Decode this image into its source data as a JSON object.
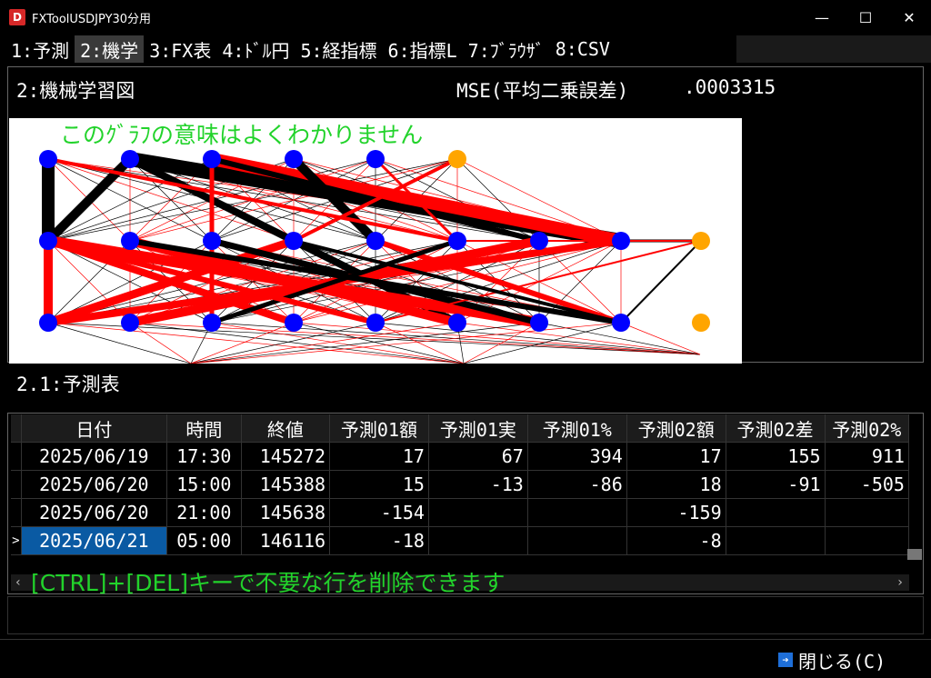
{
  "window": {
    "title": "FXToolUSDJPY30分用",
    "icon_letter": "D"
  },
  "tabs": [
    {
      "label": "1:予測",
      "active": false
    },
    {
      "label": "2:機学",
      "active": true
    },
    {
      "label": "3:FX表",
      "active": false
    },
    {
      "label": "4:ﾄﾞﾙ円",
      "active": false
    },
    {
      "label": "5:経指標",
      "active": false
    },
    {
      "label": "6:指標L",
      "active": false
    },
    {
      "label": "7:ﾌﾞﾗｳｻﾞ",
      "active": false
    },
    {
      "label": "8:CSV",
      "active": false
    }
  ],
  "ml_section": {
    "title": "2:機械学習図",
    "mse_label": "MSE(平均二乗誤差)",
    "mse_value": ".0003315",
    "chart_note": "このｸﾞﾗﾌの意味はよくわかりません"
  },
  "forecast_section": {
    "title": "2.1:予測表",
    "columns": [
      "日付",
      "時間",
      "終値",
      "予測01額",
      "予測01実",
      "予測01%",
      "予測02額",
      "予測02差",
      "予測02%"
    ],
    "rows": [
      [
        "2025/06/19",
        "17:30",
        "145272",
        "17",
        "67",
        "394",
        "17",
        "155",
        "911"
      ],
      [
        "2025/06/20",
        "15:00",
        "145388",
        "15",
        "-13",
        "-86",
        "18",
        "-91",
        "-505"
      ],
      [
        "2025/06/20",
        "21:00",
        "145638",
        "-154",
        "",
        "",
        "-159",
        "",
        ""
      ],
      [
        "2025/06/21",
        "05:00",
        "146116",
        "-18",
        "",
        "",
        "-8",
        "",
        ""
      ]
    ],
    "current_row_marker": ">",
    "hint": "[CTRL]+[DEL]キーで不要な行を削除できます"
  },
  "footer": {
    "close_label": "閉じる(C)"
  },
  "colors": {
    "hint_green": "#22d32b",
    "selected_blue": "#0a5aa3",
    "node_blue": "#0000ff",
    "node_orange": "#ffa500",
    "edge_red": "#ff0000",
    "edge_black": "#000000"
  }
}
